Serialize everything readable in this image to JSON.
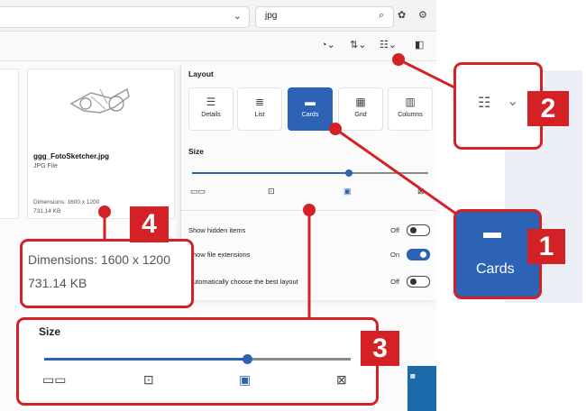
{
  "search": {
    "value": "jpg"
  },
  "file": {
    "name": "ggg_FotoSketcher.jpg",
    "type": "JPG File",
    "dimensions": "Dimensions: 1600 x 1200",
    "size": "731.14 KB"
  },
  "panel": {
    "layout_title": "Layout",
    "layouts": [
      {
        "label": "Details",
        "icon": "☰"
      },
      {
        "label": "List",
        "icon": "≣"
      },
      {
        "label": "Cards",
        "icon": "▬"
      },
      {
        "label": "Grid",
        "icon": "▦"
      },
      {
        "label": "Columns",
        "icon": "▥"
      }
    ],
    "selected_layout": "Cards",
    "size_title": "Size",
    "size_level": 0.66,
    "toggles": [
      {
        "label": "Show hidden items",
        "state": "Off",
        "on": false
      },
      {
        "label": "Show file extensions",
        "state": "On",
        "on": true
      },
      {
        "label": "Automatically choose the best layout",
        "state": "Off",
        "on": false
      }
    ]
  },
  "callouts": {
    "one": {
      "number": "1",
      "label": "Cards"
    },
    "two": {
      "number": "2"
    },
    "three": {
      "number": "3",
      "title": "Size"
    },
    "four": {
      "number": "4",
      "dimensions": "Dimensions: 1600 x 1200",
      "size": "731.14 KB"
    }
  },
  "colors": {
    "accent": "#2d63b5",
    "callout": "#d42126"
  }
}
